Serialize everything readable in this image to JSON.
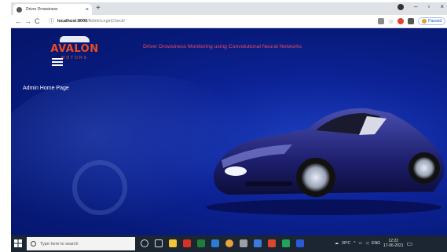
{
  "browser": {
    "tab_title": "Driver Drowsiness",
    "tab_close": "×",
    "new_tab": "+",
    "url_host": "localhost:8000",
    "url_path": "/AdminLoginCheck/",
    "profile_label": "Paused",
    "win_minimize": "–",
    "win_maximize": "▫",
    "win_close": "×",
    "back": "←",
    "forward": "→",
    "reload": "C",
    "menu": "⋮"
  },
  "page": {
    "logo_text": "AVALON",
    "logo_sub": "MOTORS",
    "headline": "Driver Drowsiness Monitoring using Convolutional Neural Networks",
    "admin_label": "Admin Home Page",
    "accent_color": "#ea4c23",
    "headline_color": "#ec4a5a",
    "background_color": "#0c2296"
  },
  "taskbar": {
    "search_placeholder": "Type here to search",
    "weather": "30°C",
    "language": "ENG",
    "time": "12:22",
    "date": "17-06-2021"
  }
}
